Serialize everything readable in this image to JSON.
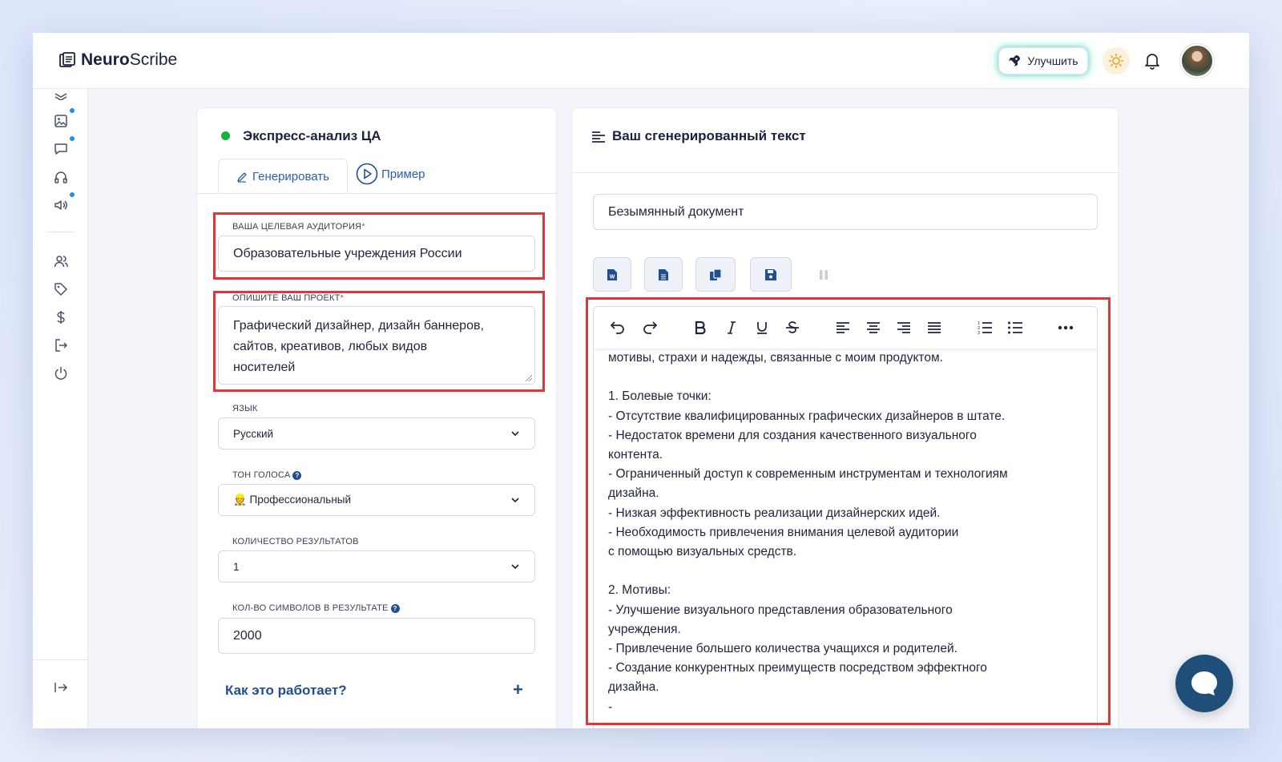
{
  "app": {
    "logo_a": "Neuro",
    "logo_b": "Scribe"
  },
  "header": {
    "upgrade_label": "Улучшить"
  },
  "left": {
    "title": "Экспресс-анализ ЦА",
    "tabs": {
      "generate": "Генерировать",
      "example": "Пример"
    },
    "audience": {
      "label": "ВАША ЦЕЛЕВАЯ АУДИТОРИЯ",
      "value": "Образовательные учреждения России"
    },
    "project": {
      "label": "ОПИШИТЕ ВАШ ПРОЕКТ",
      "lines": [
        "Графический дизайнер, дизайн баннеров,",
        "сайтов, креативов, любых видов",
        "носителей"
      ]
    },
    "language": {
      "label": "ЯЗЫК",
      "value": "Русский"
    },
    "tone": {
      "label": "ТОН ГОЛОСА",
      "value": "👷 Профессиональный"
    },
    "count": {
      "label": "КОЛИЧЕСТВО РЕЗУЛЬТАТОВ",
      "value": "1"
    },
    "chars": {
      "label": "КОЛ-ВО СИМВОЛОВ В РЕЗУЛЬТАТЕ",
      "value": "2000"
    },
    "how": "Как это работает?",
    "plus": "+",
    "required_mark": "*",
    "help_mark": "?"
  },
  "right": {
    "title": "Ваш сгенерированный текст",
    "doc_name": "Безымянный документ",
    "content": "мотивы, страхи и надежды, связанные с моим продуктом.\n\n1. Болевые точки:\n- Отсутствие квалифицированных графических дизайнеров в штате.\n- Недостаток времени для создания качественного визуального\nконтента.\n- Ограниченный доступ к современным инструментам и технологиям\nдизайна.\n- Низкая эффективность реализации дизайнерских идей.\n- Необходимость привлечения внимания целевой аудитории\nс помощью визуальных средств.\n\n2. Мотивы:\n- Улучшение визуального представления образовательного\nучреждения.\n- Привлечение большего количества учащихся и родителей.\n- Создание конкурентных преимуществ посредством эффектного\nдизайна.\n-"
  },
  "colors": {
    "accent": "#1f4f8f",
    "highlight": "#e0353b",
    "status": "#18b23a"
  }
}
